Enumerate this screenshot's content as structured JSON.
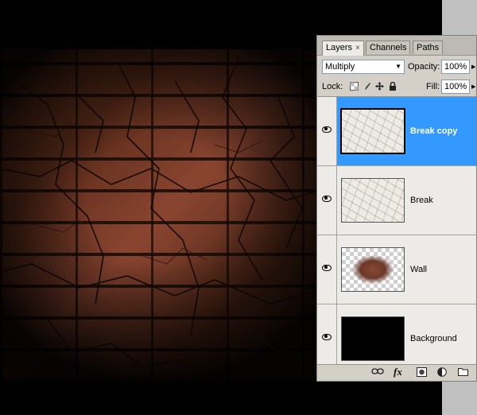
{
  "panel": {
    "tabs": [
      {
        "label": "Layers",
        "close": "×"
      },
      {
        "label": "Channels"
      },
      {
        "label": "Paths"
      }
    ],
    "blend_mode": "Multiply",
    "opacity_label": "Opacity:",
    "opacity_value": "100%",
    "lock_label": "Lock:",
    "fill_label": "Fill:",
    "fill_value": "100%",
    "layers": [
      {
        "name": "Break copy",
        "visible": true,
        "selected": true,
        "thumbnail": "cracked-texture"
      },
      {
        "name": "Break",
        "visible": true,
        "selected": false,
        "thumbnail": "cracked-texture"
      },
      {
        "name": "Wall",
        "visible": true,
        "selected": false,
        "thumbnail": "brick-wall-transparent"
      },
      {
        "name": "Background",
        "visible": true,
        "selected": false,
        "thumbnail": "black-fill"
      }
    ],
    "footer_icons": [
      "link-icon",
      "fx-icon",
      "mask-icon",
      "adjustment-icon",
      "folder-icon"
    ],
    "selection_color": "#3399ff"
  }
}
